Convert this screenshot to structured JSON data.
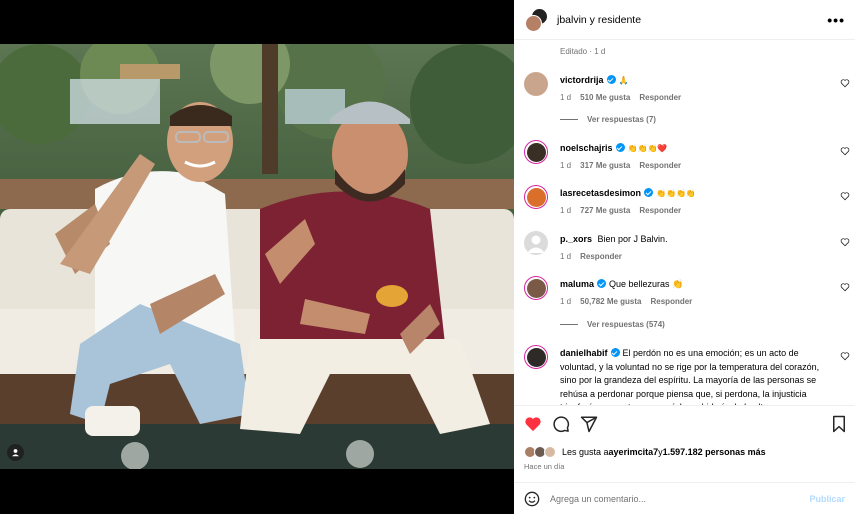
{
  "header": {
    "title": "jbalvin y residente"
  },
  "edited": "Editado · 1 d",
  "comments": [
    {
      "user": "victordrija",
      "verified": true,
      "text": "🙏",
      "time": "1 d",
      "likes": "510 Me gusta",
      "reply": "Responder",
      "replies": "Ver respuestas (7)"
    },
    {
      "user": "noelschajris",
      "verified": true,
      "text": "👏👏👏❤️",
      "time": "1 d",
      "likes": "317 Me gusta",
      "reply": "Responder"
    },
    {
      "user": "lasrecetasdesimon",
      "verified": true,
      "text": "👏👏👏👏",
      "time": "1 d",
      "likes": "727 Me gusta",
      "reply": "Responder"
    },
    {
      "user": "p._xors",
      "verified": false,
      "text": "Bien por J Balvin.",
      "time": "1 d",
      "reply": "Responder"
    },
    {
      "user": "maluma",
      "verified": true,
      "text": "Que bellezuras 👏",
      "time": "1 d",
      "likes": "50,782 Me gusta",
      "reply": "Responder",
      "replies": "Ver respuestas (574)"
    },
    {
      "user": "danielhabif",
      "verified": true,
      "text": "El perdón no es una emoción; es un acto de voluntad, y la voluntad no se rige por la temperatura del corazón, sino por la grandeza del espíritu. La mayoría de las personas se rehúsa a perdonar porque piensa que, si perdona, la injusticia triunfará; pero esto no es así. La sabiduría de lo alto"
    }
  ],
  "likes_bar": {
    "prefix": "Les gusta a ",
    "user": "ayerimcita7",
    "middle": " y ",
    "count": "1.597.182 personas más"
  },
  "time_ago": "Hace un día",
  "add_comment": {
    "placeholder": "Agrega un comentario...",
    "post_label": "Publicar"
  },
  "colors": {
    "like_red": "#ff3040",
    "verified_blue": "#0095f6",
    "post_disabled": "#b3dbff"
  }
}
